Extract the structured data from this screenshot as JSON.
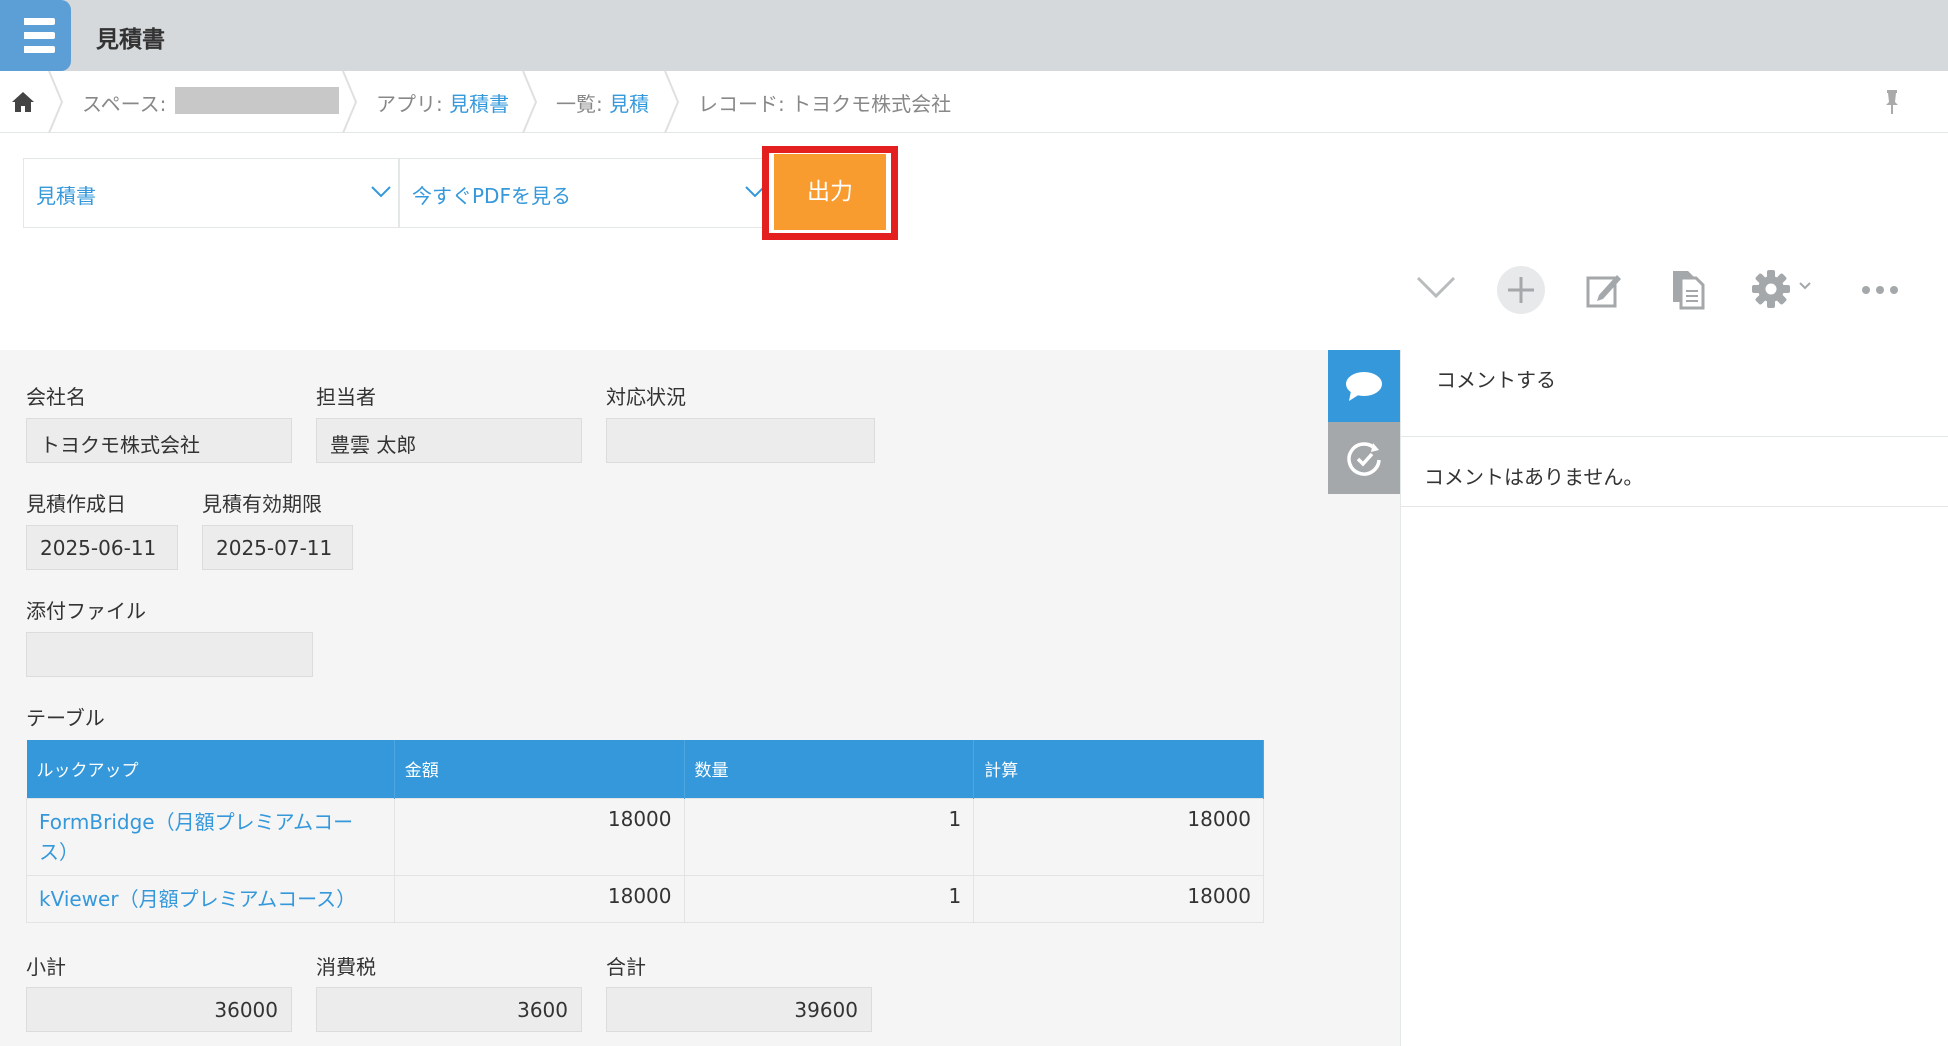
{
  "header": {
    "title": "見積書"
  },
  "breadcrumb": {
    "space_label": "スペース:",
    "app_label": "アプリ:",
    "app_value": "見積書",
    "list_label": "一覧:",
    "list_value": "見積",
    "record_label": "レコード:",
    "record_value": "トヨクモ株式会社"
  },
  "toolbar": {
    "template_select": "見積書",
    "action_select": "今すぐPDFを見る",
    "output_button": "出力"
  },
  "record": {
    "company": {
      "label": "会社名",
      "value": "トヨクモ株式会社"
    },
    "person": {
      "label": "担当者",
      "value": "豊雲 太郎"
    },
    "status": {
      "label": "対応状況",
      "value": ""
    },
    "created": {
      "label": "見積作成日",
      "value": "2025-06-11"
    },
    "expires": {
      "label": "見積有効期限",
      "value": "2025-07-11"
    },
    "attachment": {
      "label": "添付ファイル",
      "value": ""
    },
    "table_label": "テーブル",
    "table": {
      "headers": [
        "ルックアップ",
        "金額",
        "数量",
        "計算"
      ],
      "rows": [
        {
          "lookup": "FormBridge（月額プレミアムコース）",
          "amount": "18000",
          "qty": "1",
          "calc": "18000"
        },
        {
          "lookup": "kViewer（月額プレミアムコース）",
          "amount": "18000",
          "qty": "1",
          "calc": "18000"
        }
      ]
    },
    "subtotal": {
      "label": "小計",
      "value": "36000"
    },
    "tax": {
      "label": "消費税",
      "value": "3600"
    },
    "total": {
      "label": "合計",
      "value": "39600"
    }
  },
  "comments": {
    "input_placeholder": "コメントする",
    "empty_text": "コメントはありません。"
  },
  "colors": {
    "accent": "#3498db",
    "output_button": "#f89c30",
    "highlight": "#e41f1f"
  }
}
